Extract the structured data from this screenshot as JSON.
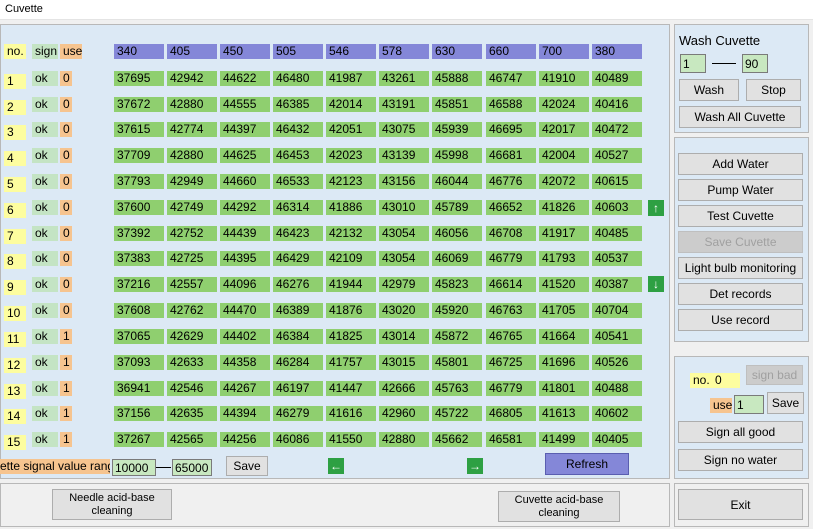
{
  "window": {
    "title": "Cuvette"
  },
  "table": {
    "headers": {
      "no": "no.",
      "sign": "sign",
      "use": "use"
    },
    "wavelengths": [
      "340",
      "405",
      "450",
      "505",
      "546",
      "578",
      "630",
      "660",
      "700",
      "380"
    ],
    "rows": [
      {
        "no": "1",
        "sign": "ok",
        "use": "0",
        "values": [
          "37695",
          "42942",
          "44622",
          "46480",
          "41987",
          "43261",
          "45888",
          "46747",
          "41910",
          "40489"
        ]
      },
      {
        "no": "2",
        "sign": "ok",
        "use": "0",
        "values": [
          "37672",
          "42880",
          "44555",
          "46385",
          "42014",
          "43191",
          "45851",
          "46588",
          "42024",
          "40416"
        ]
      },
      {
        "no": "3",
        "sign": "ok",
        "use": "0",
        "values": [
          "37615",
          "42774",
          "44397",
          "46432",
          "42051",
          "43075",
          "45939",
          "46695",
          "42017",
          "40472"
        ]
      },
      {
        "no": "4",
        "sign": "ok",
        "use": "0",
        "values": [
          "37709",
          "42880",
          "44625",
          "46453",
          "42023",
          "43139",
          "45998",
          "46681",
          "42004",
          "40527"
        ]
      },
      {
        "no": "5",
        "sign": "ok",
        "use": "0",
        "values": [
          "37793",
          "42949",
          "44660",
          "46533",
          "42123",
          "43156",
          "46044",
          "46776",
          "42072",
          "40615"
        ]
      },
      {
        "no": "6",
        "sign": "ok",
        "use": "0",
        "values": [
          "37600",
          "42749",
          "44292",
          "46314",
          "41886",
          "43010",
          "45789",
          "46652",
          "41826",
          "40603"
        ]
      },
      {
        "no": "7",
        "sign": "ok",
        "use": "0",
        "values": [
          "37392",
          "42752",
          "44439",
          "46423",
          "42132",
          "43054",
          "46056",
          "46708",
          "41917",
          "40485"
        ]
      },
      {
        "no": "8",
        "sign": "ok",
        "use": "0",
        "values": [
          "37383",
          "42725",
          "44395",
          "46429",
          "42109",
          "43054",
          "46069",
          "46779",
          "41793",
          "40537"
        ]
      },
      {
        "no": "9",
        "sign": "ok",
        "use": "0",
        "values": [
          "37216",
          "42557",
          "44096",
          "46276",
          "41944",
          "42979",
          "45823",
          "46614",
          "41520",
          "40387"
        ]
      },
      {
        "no": "10",
        "sign": "ok",
        "use": "0",
        "values": [
          "37608",
          "42762",
          "44470",
          "46389",
          "41876",
          "43020",
          "45920",
          "46763",
          "41705",
          "40704"
        ]
      },
      {
        "no": "11",
        "sign": "ok",
        "use": "1",
        "values": [
          "37065",
          "42629",
          "44402",
          "46384",
          "41825",
          "43014",
          "45872",
          "46765",
          "41664",
          "40541"
        ]
      },
      {
        "no": "12",
        "sign": "ok",
        "use": "1",
        "values": [
          "37093",
          "42633",
          "44358",
          "46284",
          "41757",
          "43015",
          "45801",
          "46725",
          "41696",
          "40526"
        ]
      },
      {
        "no": "13",
        "sign": "ok",
        "use": "1",
        "values": [
          "36941",
          "42546",
          "44267",
          "46197",
          "41447",
          "42666",
          "45763",
          "46779",
          "41801",
          "40488"
        ]
      },
      {
        "no": "14",
        "sign": "ok",
        "use": "1",
        "values": [
          "37156",
          "42635",
          "44394",
          "46279",
          "41616",
          "42960",
          "45722",
          "46805",
          "41613",
          "40602"
        ]
      },
      {
        "no": "15",
        "sign": "ok",
        "use": "1",
        "values": [
          "37267",
          "42565",
          "44256",
          "46086",
          "41550",
          "42880",
          "45662",
          "46581",
          "41499",
          "40405"
        ]
      }
    ]
  },
  "range": {
    "label": "ette signal value range",
    "min": "10000",
    "max": "65000",
    "save_label": "Save"
  },
  "refresh_label": "Refresh",
  "scroll_up_icon": "arrow-up-icon",
  "scroll_down_icon": "arrow-down-icon",
  "page_left_icon": "arrow-left-icon",
  "page_right_icon": "arrow-right-icon",
  "wash": {
    "title": "Wash Cuvette",
    "from": "1",
    "to": "90",
    "wash_label": "Wash",
    "stop_label": "Stop",
    "wash_all_label": "Wash All Cuvette"
  },
  "actions": {
    "add_water": "Add Water",
    "pump_water": "Pump Water",
    "test_cuvette": "Test Cuvette",
    "save_cuvette": "Save Cuvette",
    "light_bulb": "Light bulb monitoring",
    "det_records": "Det records",
    "use_record": "Use record"
  },
  "sign_panel": {
    "no_label": "no.",
    "no_value": "0",
    "sign_bad_label": "sign bad",
    "use_label": "use",
    "use_value": "1",
    "save_label": "Save",
    "sign_all_good": "Sign all good",
    "sign_no_water": "Sign no water"
  },
  "bottom": {
    "needle_clean": "Needle acid-base cleaning",
    "cuvette_clean": "Cuvette acid-base cleaning",
    "exit": "Exit"
  },
  "colors": {
    "panel_bg": "#dce9f5",
    "value_cell": "#8fcf6f",
    "wavelength_cell": "#8487d8",
    "no_cell": "#fdfd9f",
    "sign_cell": "#c4e4c4",
    "use_cell": "#f6c48f",
    "arrow_green": "#2ea043"
  }
}
